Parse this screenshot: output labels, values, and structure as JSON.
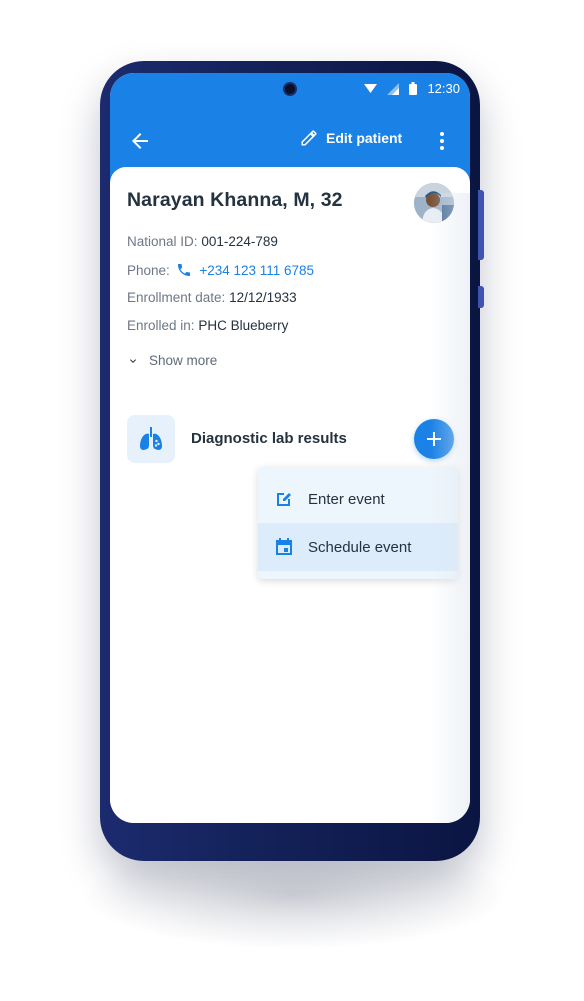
{
  "colors": {
    "primary": "#1a81e6",
    "text": "#25323f",
    "secondary_text": "#6d7885"
  },
  "status_bar": {
    "time": "12:30",
    "icons": [
      "wifi-icon",
      "signal-icon",
      "battery-icon"
    ]
  },
  "toolbar": {
    "back_icon": "arrow-left-icon",
    "edit_label": "Edit patient",
    "menu_icon": "more-vert-icon"
  },
  "patient": {
    "name": "Narayan Khanna, M, 32",
    "national_id_label": "National ID:",
    "national_id": "001-224-789",
    "phone_label": "Phone:",
    "phone": "+234 123 111 6785",
    "enrollment_date_label": "Enrollment date:",
    "enrollment_date": "12/12/1933",
    "enrolled_in_label": "Enrolled in:",
    "enrolled_in": "PHC Blueberry",
    "show_more": "Show more"
  },
  "stage": {
    "title": "Diagnostic lab results",
    "icon": "lungs-icon",
    "add_icon": "plus-icon"
  },
  "popup_menu": {
    "items": [
      {
        "label": "Enter event",
        "icon": "edit-note-icon"
      },
      {
        "label": "Schedule event",
        "icon": "calendar-icon"
      }
    ]
  }
}
